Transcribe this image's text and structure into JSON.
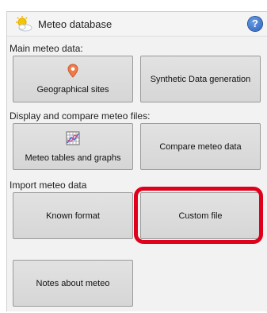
{
  "window": {
    "title": "Meteo database",
    "icons": {
      "title_icon": "sun-cloud-icon",
      "help_icon": "help-icon"
    },
    "help_symbol": "?"
  },
  "sections": {
    "main": "Main meteo data:",
    "display": "Display and compare meteo files:",
    "import": "Import meteo data"
  },
  "buttons": {
    "geo_sites": {
      "label": "Geographical sites",
      "icon": "map-pin-icon"
    },
    "synthetic": {
      "label": "Synthetic Data generation"
    },
    "meteo_tables": {
      "label": "Meteo tables and graphs",
      "icon": "chart-grid-icon"
    },
    "compare": {
      "label": "Compare meteo data"
    },
    "known_format": {
      "label": "Known format"
    },
    "custom_file": {
      "label": "Custom file"
    },
    "notes": {
      "label": "Notes about meteo"
    }
  },
  "colors": {
    "highlight": "#e0001b",
    "help": "#2b5fb8"
  }
}
